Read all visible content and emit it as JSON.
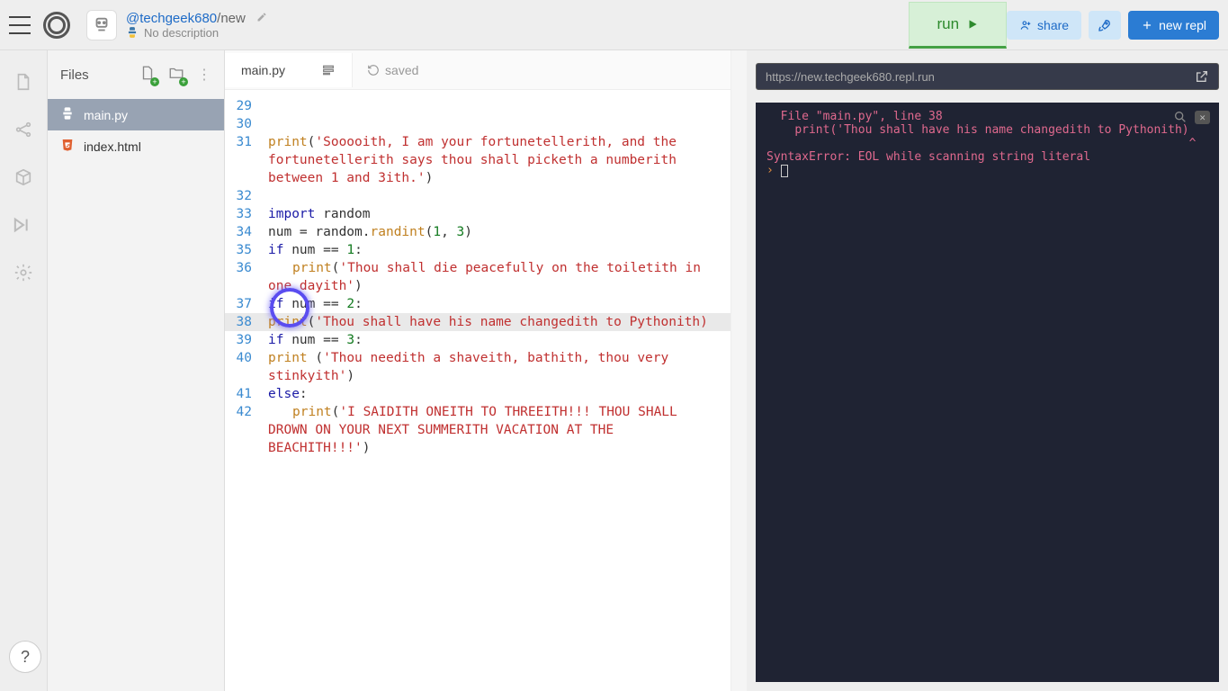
{
  "header": {
    "user": "@techgeek680",
    "project": "new",
    "description": "No description",
    "run_label": "run",
    "share_label": "share",
    "new_repl_label": "new repl"
  },
  "files_panel": {
    "title": "Files",
    "items": [
      {
        "name": "main.py",
        "icon": "python",
        "active": true
      },
      {
        "name": "index.html",
        "icon": "html",
        "active": false
      }
    ]
  },
  "editor": {
    "tab": "main.py",
    "saved_label": "saved",
    "highlight_line": 38,
    "lines": [
      {
        "n": 29,
        "html": ""
      },
      {
        "n": 30,
        "html": ""
      },
      {
        "n": 31,
        "html": "<span class='fn'>print</span>(<span class='str'>'Sooooith, I am your fortunetellerith, and the fortunetellerith says thou shall picketh a numberith between 1 and 3ith.'</span>)"
      },
      {
        "n": 32,
        "html": ""
      },
      {
        "n": 33,
        "html": "<span class='kw'>import</span> random"
      },
      {
        "n": 34,
        "html": "num <span class='op'>=</span> random.<span class='fn'>randint</span>(<span class='num'>1</span>, <span class='num'>3</span>)"
      },
      {
        "n": 35,
        "html": "<span class='kw'>if</span> num <span class='op'>==</span> <span class='num'>1</span>:"
      },
      {
        "n": 36,
        "html": "<span class='indent-guide'></span><span class='fn'>print</span>(<span class='str'>'Thou shall die peacefully on the toiletith in one dayith'</span>)",
        "wrap_pad": 48
      },
      {
        "n": 37,
        "html": "<span class='kw'>if</span> num <span class='op'>==</span> <span class='num'>2</span>:"
      },
      {
        "n": 38,
        "html": "<span class='fn'>print</span>(<span class='str'>'Thou shall have his name changedith to Pythonith)</span>"
      },
      {
        "n": 39,
        "html": "<span class='kw'>if</span> num <span class='op'>==</span> <span class='num'>3</span>:"
      },
      {
        "n": 40,
        "html": "<span class='fn'>print</span> (<span class='str'>'Thou needith a shaveith, bathith, thou very stinkyith'</span>)"
      },
      {
        "n": 41,
        "html": "<span class='kw'>else</span>:"
      },
      {
        "n": 42,
        "html": "<span class='indent-guide'></span><span class='fn'>print</span>(<span class='str'>'I SAIDITH ONEITH TO THREEITH!!! THOU SHALL DROWN ON YOUR NEXT SUMMERITH VACATION AT THE BEACHITH!!!'</span>)",
        "wrap_pad": 48
      }
    ]
  },
  "terminal": {
    "url": "https://new.techgeek680.repl.run",
    "output": [
      {
        "cls": "red",
        "text": "  File \"main.py\", line 38"
      },
      {
        "cls": "red",
        "text": "    print('Thou shall have his name changedith to Pythonith)"
      },
      {
        "cls": "red",
        "text": "                                                            ^"
      },
      {
        "cls": "red",
        "text": "SyntaxError: EOL while scanning string literal"
      }
    ]
  },
  "help_label": "?"
}
